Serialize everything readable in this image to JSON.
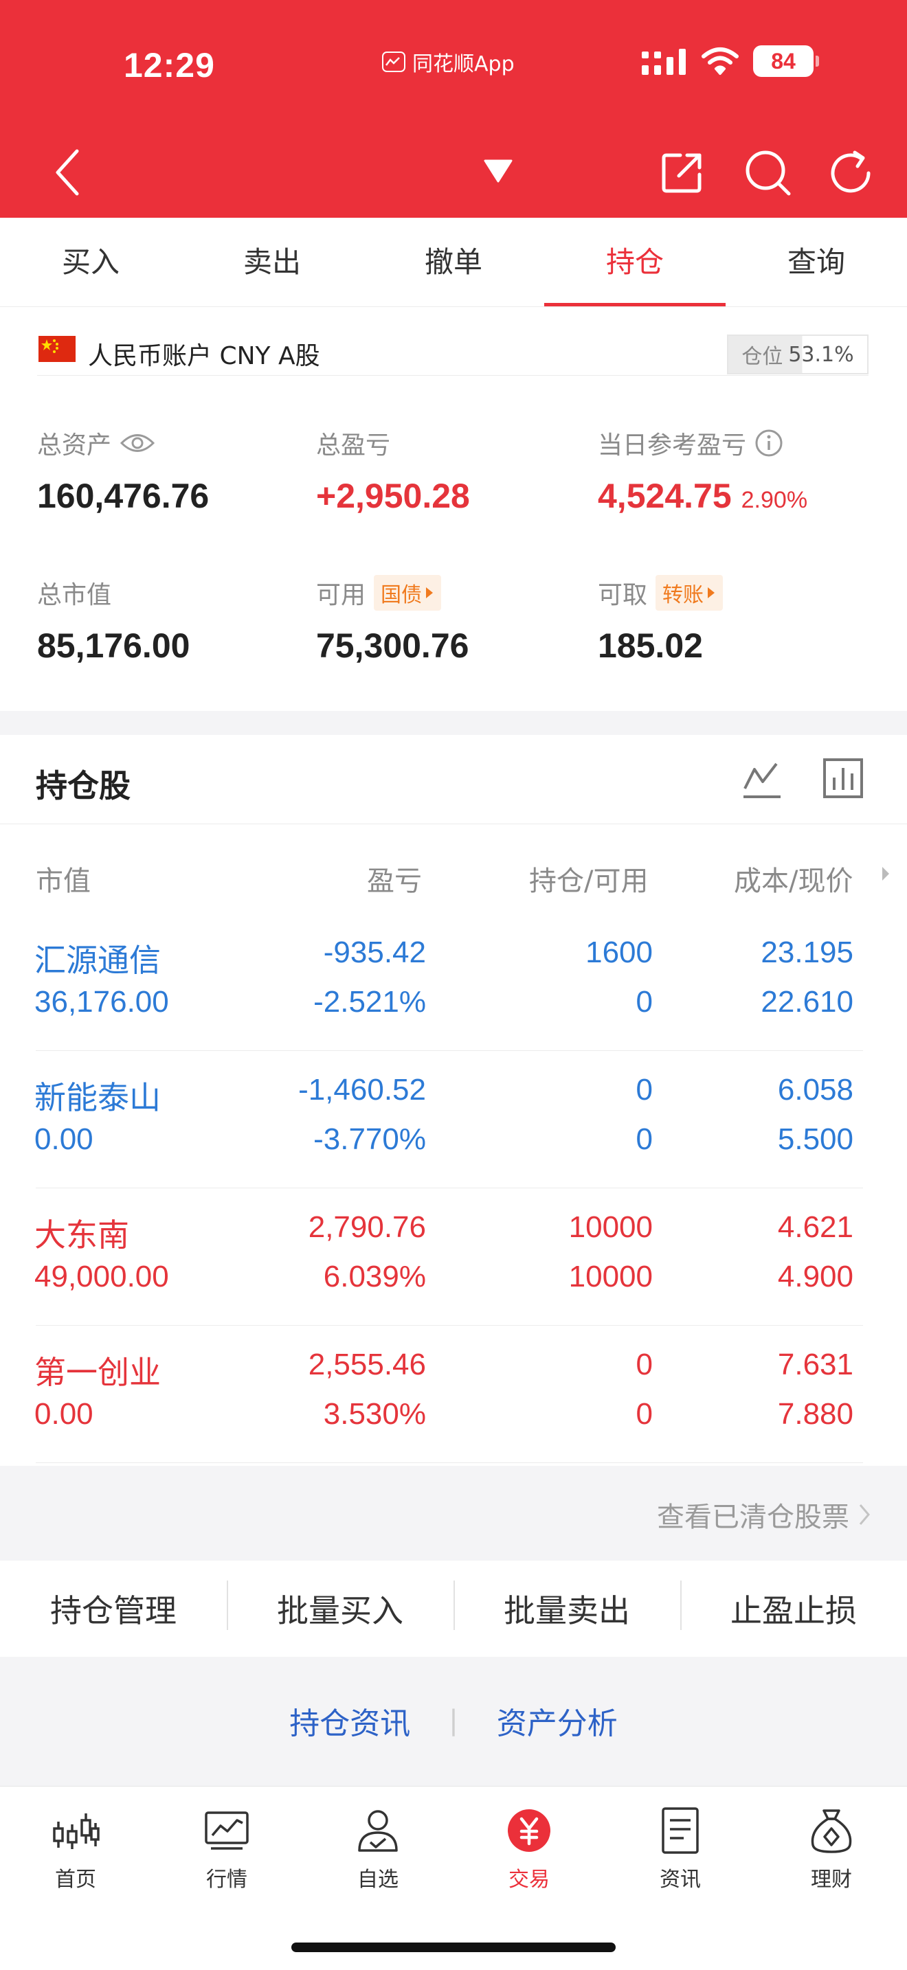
{
  "status_bar": {
    "time": "12:29",
    "app_name": "同花顺App",
    "battery": "84"
  },
  "tabs": [
    {
      "label": "买入"
    },
    {
      "label": "卖出"
    },
    {
      "label": "撤单"
    },
    {
      "label": "持仓",
      "active": true
    },
    {
      "label": "查询"
    }
  ],
  "account": {
    "name": "人民币账户 CNY A股",
    "position_label": "仓位",
    "position_value": "53.1%",
    "total_assets_label": "总资产",
    "total_assets": "160,476.76",
    "total_pnl_label": "总盈亏",
    "total_pnl": "+2,950.28",
    "daily_pnl_label": "当日参考盈亏",
    "daily_pnl": "4,524.75",
    "daily_pnl_pct": "2.90%",
    "market_value_label": "总市值",
    "market_value": "85,176.00",
    "available_label": "可用",
    "available_tag": "国债",
    "available": "75,300.76",
    "withdrawable_label": "可取",
    "withdrawable_tag": "转账",
    "withdrawable": "185.02"
  },
  "holdings": {
    "title": "持仓股",
    "columns": [
      "市值",
      "盈亏",
      "持仓/可用",
      "成本/现价"
    ],
    "rows": [
      {
        "name": "汇源通信",
        "market_value": "36,176.00",
        "pnl": "-935.42",
        "pnl_pct": "-2.521%",
        "position": "1600",
        "available": "0",
        "cost": "23.195",
        "price": "22.610",
        "color": "#2c7ad6"
      },
      {
        "name": "新能泰山",
        "market_value": "0.00",
        "pnl": "-1,460.52",
        "pnl_pct": "-3.770%",
        "position": "0",
        "available": "0",
        "cost": "6.058",
        "price": "5.500",
        "color": "#2c7ad6"
      },
      {
        "name": "大东南",
        "market_value": "49,000.00",
        "pnl": "2,790.76",
        "pnl_pct": "6.039%",
        "position": "10000",
        "available": "10000",
        "cost": "4.621",
        "price": "4.900",
        "color": "#e5343b"
      },
      {
        "name": "第一创业",
        "market_value": "0.00",
        "pnl": "2,555.46",
        "pnl_pct": "3.530%",
        "position": "0",
        "available": "0",
        "cost": "7.631",
        "price": "7.880",
        "color": "#e5343b"
      }
    ],
    "cleared_link": "查看已清仓股票"
  },
  "actions": [
    "持仓管理",
    "批量买入",
    "批量卖出",
    "止盈止损"
  ],
  "links": [
    "持仓资讯",
    "资产分析"
  ],
  "bottom_nav": [
    {
      "label": "首页",
      "icon": "candlestick-icon"
    },
    {
      "label": "行情",
      "icon": "market-chart-icon"
    },
    {
      "label": "自选",
      "icon": "person-check-icon"
    },
    {
      "label": "交易",
      "icon": "yuan-trade-icon",
      "active": true
    },
    {
      "label": "资讯",
      "icon": "news-document-icon"
    },
    {
      "label": "理财",
      "icon": "money-bag-icon"
    }
  ],
  "colors": {
    "brand_red": "#eb303a",
    "gain": "#e5343b",
    "loss": "#2c7ad6",
    "tag_orange": "#f07a1e",
    "link_blue": "#2d62c7"
  }
}
